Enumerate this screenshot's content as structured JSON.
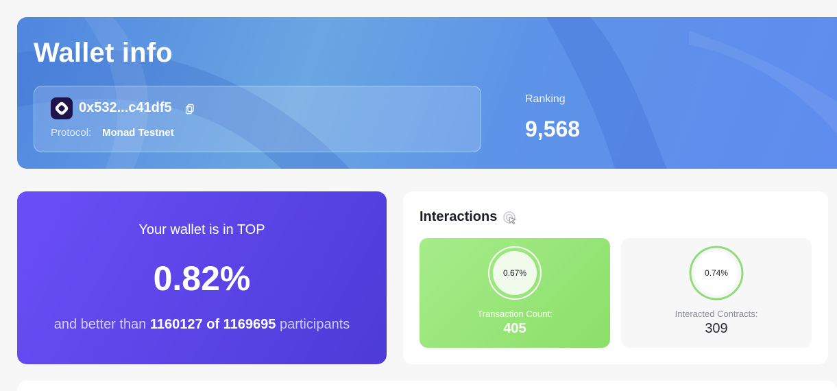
{
  "banner": {
    "title": "Wallet info",
    "wallet": {
      "address": "0x532...c41df5",
      "protocol_label": "Protocol:",
      "protocol_value": "Monad Testnet",
      "logo_icon": "monad-logo-icon",
      "copy_icon": "copy-icon"
    },
    "ranking": {
      "label": "Ranking",
      "value": "9,568"
    }
  },
  "top": {
    "heading": "Your wallet is in TOP",
    "percent": "0.82%",
    "sub_prefix": "and better than",
    "better_than": "1160127",
    "of_word": "of",
    "total": "1169695",
    "sub_suffix": "participants"
  },
  "interactions": {
    "title": "Interactions",
    "title_icon": "cursor-click-icon",
    "stats": [
      {
        "ring_label": "0.67%",
        "ring_fraction": 0.0067,
        "label": "Transaction Count:",
        "value": "405",
        "color": "#8bdf69"
      },
      {
        "ring_label": "0.74%",
        "ring_fraction": 0.0074,
        "label": "Interacted Contracts:",
        "value": "309",
        "color": "#8fdc78"
      }
    ]
  },
  "colors": {
    "banner_accent": "#5d93e8",
    "top_card": "#5a44e6",
    "green": "#8bdf69",
    "text_dark": "#1c1d2b"
  }
}
